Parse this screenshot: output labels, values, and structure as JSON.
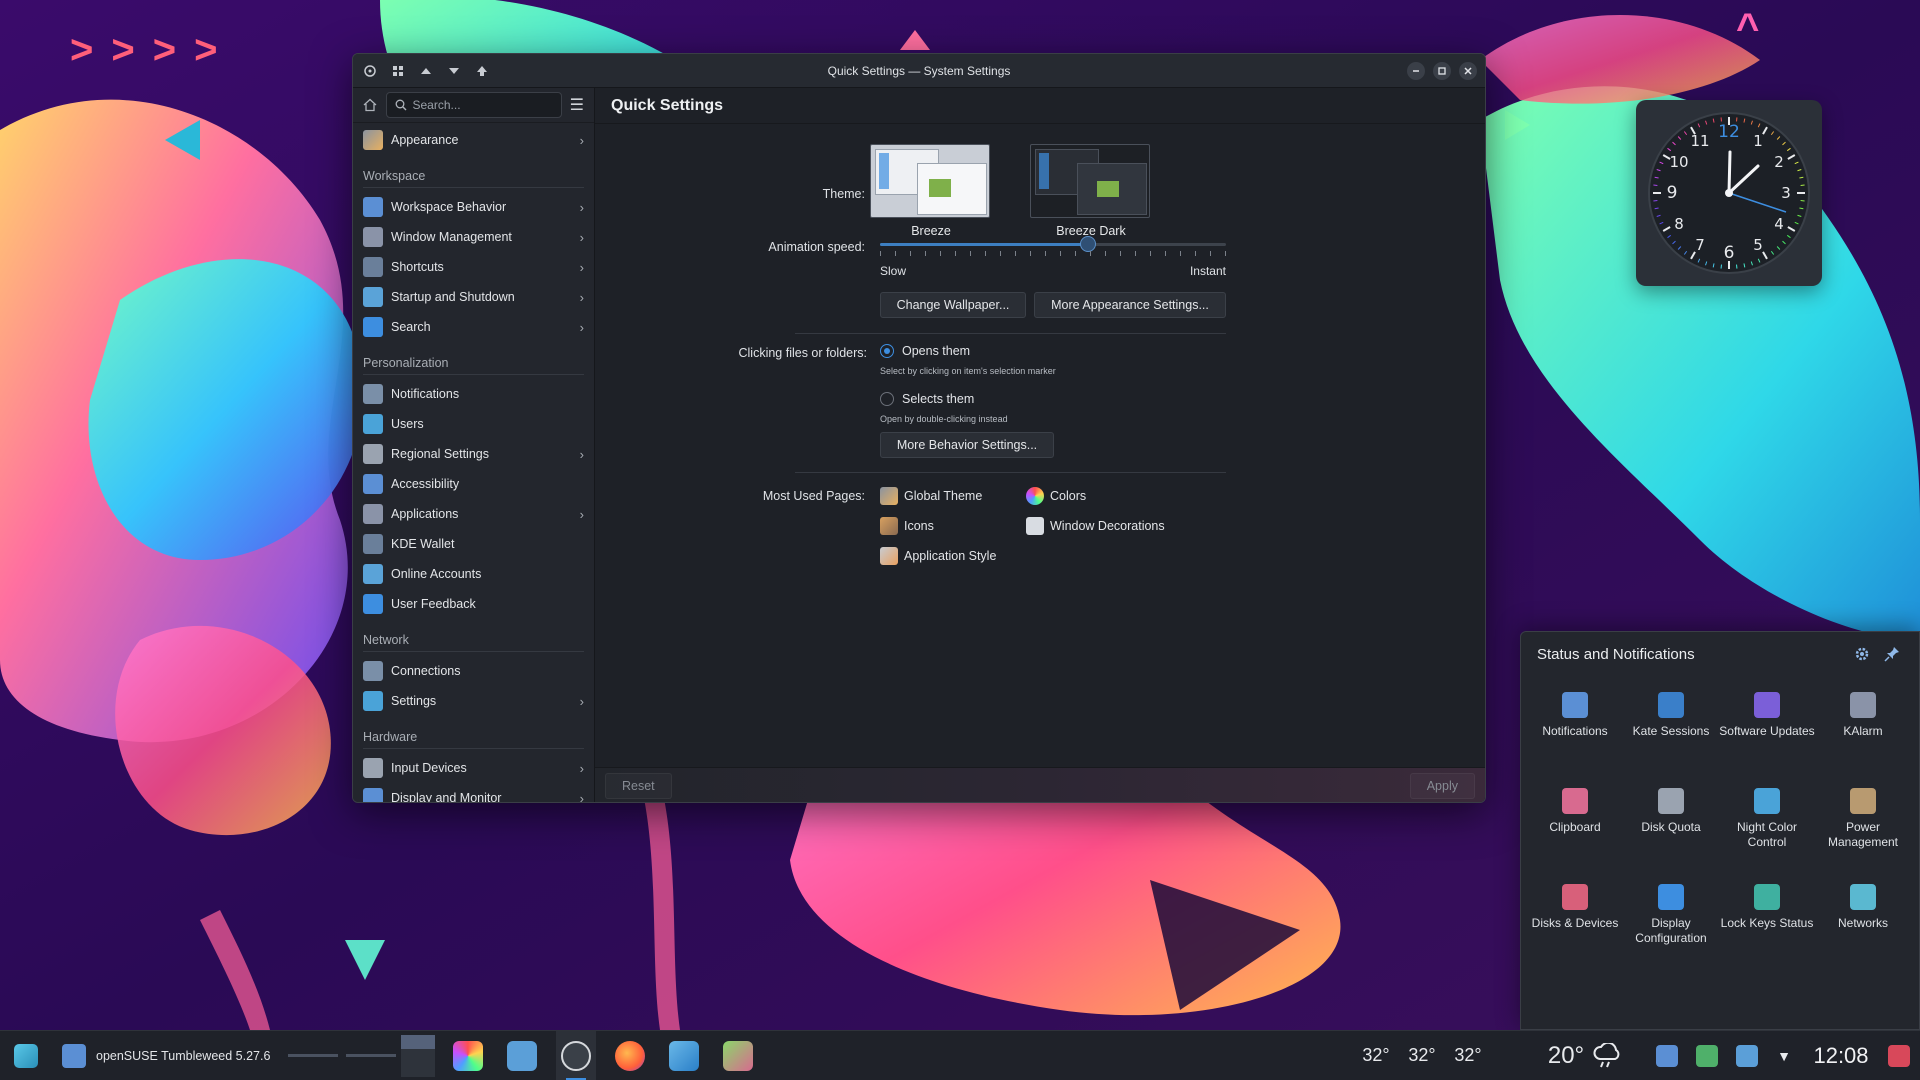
{
  "window": {
    "title": "Quick Settings — System Settings"
  },
  "sidebar": {
    "search_placeholder": "Search...",
    "top_item": {
      "label": "Appearance"
    },
    "sections": [
      {
        "title": "Workspace",
        "items": [
          {
            "label": "Workspace Behavior",
            "chevron": true
          },
          {
            "label": "Window Management",
            "chevron": true
          },
          {
            "label": "Shortcuts",
            "chevron": true
          },
          {
            "label": "Startup and Shutdown",
            "chevron": true
          },
          {
            "label": "Search",
            "chevron": true
          }
        ]
      },
      {
        "title": "Personalization",
        "items": [
          {
            "label": "Notifications",
            "chevron": false
          },
          {
            "label": "Users",
            "chevron": false
          },
          {
            "label": "Regional Settings",
            "chevron": true
          },
          {
            "label": "Accessibility",
            "chevron": false
          },
          {
            "label": "Applications",
            "chevron": true
          },
          {
            "label": "KDE Wallet",
            "chevron": false
          },
          {
            "label": "Online Accounts",
            "chevron": false
          },
          {
            "label": "User Feedback",
            "chevron": false
          }
        ]
      },
      {
        "title": "Network",
        "items": [
          {
            "label": "Connections",
            "chevron": false
          },
          {
            "label": "Settings",
            "chevron": true
          }
        ]
      },
      {
        "title": "Hardware",
        "items": [
          {
            "label": "Input Devices",
            "chevron": true
          },
          {
            "label": "Display and Monitor",
            "chevron": true
          }
        ]
      }
    ]
  },
  "content": {
    "title": "Quick Settings",
    "theme_label": "Theme:",
    "themes": [
      {
        "name": "Breeze",
        "selected": true
      },
      {
        "name": "Breeze Dark",
        "selected": false
      }
    ],
    "animation_label": "Animation speed:",
    "animation_level": 0.6,
    "slider_min_label": "Slow",
    "slider_max_label": "Instant",
    "change_wallpaper_btn": "Change Wallpaper...",
    "more_appearance_btn": "More Appearance Settings...",
    "clicking_label": "Clicking files or folders:",
    "radio_opens": "Opens them",
    "radio_opens_hint": "Select by clicking on item's selection marker",
    "radio_selects": "Selects them",
    "radio_selects_hint": "Open by double-clicking instead",
    "more_behavior_btn": "More Behavior Settings...",
    "most_used_label": "Most Used Pages:",
    "most_used": [
      "Global Theme",
      "Colors",
      "Icons",
      "Window Decorations",
      "Application Style"
    ],
    "reset_btn": "Reset",
    "apply_btn": "Apply"
  },
  "status_panel": {
    "title": "Status and Notifications",
    "items": [
      {
        "label": "Notifications",
        "color": "#5b8fd4"
      },
      {
        "label": "Kate Sessions",
        "color": "#3a7fc9"
      },
      {
        "label": "Software Updates",
        "color": "#7b5fd8"
      },
      {
        "label": "KAlarm",
        "color": "#8a93a8"
      },
      {
        "label": "Clipboard",
        "color": "#d86a8f"
      },
      {
        "label": "Disk Quota",
        "color": "#9aa3b0"
      },
      {
        "label": "Night Color Control",
        "color": "#4aa3d8"
      },
      {
        "label": "Power Management",
        "color": "#b89a70"
      },
      {
        "label": "Disks & Devices",
        "color": "#d8607a"
      },
      {
        "label": "Display Configuration",
        "color": "#3d8ee0"
      },
      {
        "label": "Lock Keys Status",
        "color": "#3fb0a0"
      },
      {
        "label": "Networks",
        "color": "#5ab8d0"
      }
    ]
  },
  "taskbar": {
    "activity_label": "openSUSE Tumbleweed 5.27.6",
    "temps": [
      "32°",
      "32°",
      "32°"
    ],
    "weather_temp": "20°",
    "clock": "12:08"
  }
}
